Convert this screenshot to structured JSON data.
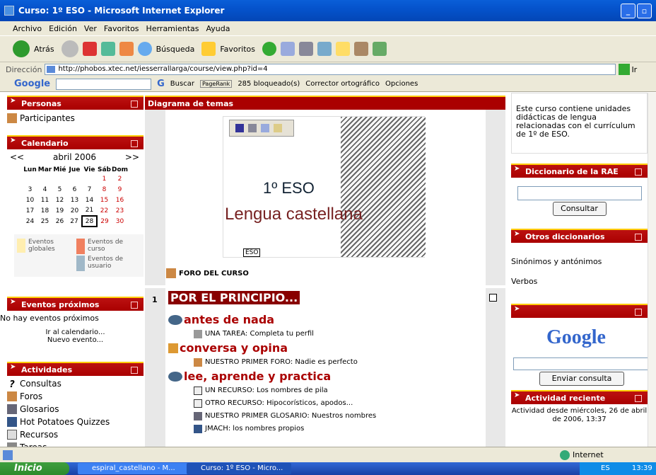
{
  "window": {
    "title": "Curso: 1º ESO - Microsoft Internet Explorer"
  },
  "menu": [
    "Archivo",
    "Edición",
    "Ver",
    "Favoritos",
    "Herramientas",
    "Ayuda"
  ],
  "toolbar": {
    "back": "Atrás",
    "search": "Búsqueda",
    "favorites": "Favoritos"
  },
  "address": {
    "label": "Dirección",
    "url": "http://phobos.xtec.net/iesserrallarga/course/view.php?id=4",
    "go": "Ir"
  },
  "googlebar": {
    "logo": "Google",
    "search": "Buscar",
    "pagerank": "PageRank",
    "blocked": "285 bloqueado(s)",
    "spell": "Corrector ortográfico",
    "options": "Opciones"
  },
  "left": {
    "personas": {
      "title": "Personas",
      "items": [
        "Participantes"
      ]
    },
    "calendario": {
      "title": "Calendario",
      "prev": "<<",
      "month": "abril 2006",
      "next": ">>",
      "days": [
        "Lun",
        "Mar",
        "Mié",
        "Jue",
        "Vie",
        "Sáb",
        "Dom"
      ],
      "weeks": [
        [
          "",
          "",
          "",
          "",
          "",
          "1",
          "2"
        ],
        [
          "3",
          "4",
          "5",
          "6",
          "7",
          "8",
          "9"
        ],
        [
          "10",
          "11",
          "12",
          "13",
          "14",
          "15",
          "16"
        ],
        [
          "17",
          "18",
          "19",
          "20",
          "21",
          "22",
          "23"
        ],
        [
          "24",
          "25",
          "26",
          "27",
          "28",
          "29",
          "30"
        ]
      ],
      "legend": {
        "global": "Eventos globales",
        "course": "Eventos de curso",
        "user": "Eventos de usuario"
      }
    },
    "eventos": {
      "title": "Eventos próximos",
      "none": "No hay eventos próximos",
      "goto": "Ir al calendario...",
      "new": "Nuevo evento..."
    },
    "actividades": {
      "title": "Actividades",
      "items": [
        "Consultas",
        "Foros",
        "Glosarios",
        "Hot Potatoes Quizzes",
        "Recursos",
        "Tareas"
      ]
    }
  },
  "main": {
    "header": "Diagrama de temas",
    "banner": {
      "line1": "1º ESO",
      "line2": "Lengua castellana",
      "tag": "ESO"
    },
    "forum": "FORO DEL CURSO",
    "section": {
      "num": "1",
      "title": "POR EL PRINCIPIO...",
      "topics": [
        {
          "heading": "antes de nada",
          "items": [
            "UNA TAREA: Completa tu perfil"
          ]
        },
        {
          "heading": "conversa y opina",
          "items": [
            "NUESTRO PRIMER FORO: Nadie es perfecto"
          ]
        },
        {
          "heading": "lee, aprende y practica",
          "items": [
            "UN RECURSO: Los nombres de pila",
            "OTRO RECURSO: Hipocorísticos, apodos...",
            "NUESTRO PRIMER GLOSARIO: Nuestros nombres",
            "JMACH: los nombres propios"
          ]
        }
      ]
    }
  },
  "right": {
    "summary": "Este curso contiene unidades didácticas de lengua relacionadas con el currículum de 1º de ESO.",
    "rae": {
      "title": "Diccionario de la RAE",
      "button": "Consultar"
    },
    "otros": {
      "title": "Otros diccionarios",
      "items": [
        "Sinónimos y antónimos",
        "Verbos"
      ]
    },
    "google": {
      "logo": "Google",
      "button": "Enviar consulta"
    },
    "reciente": {
      "title": "Actividad reciente",
      "text": "Actividad desde miércoles, 26 de abril de 2006, 13:37"
    }
  },
  "status": {
    "zone": "Internet"
  },
  "taskbar": {
    "start": "Inicio",
    "task1": "espiral_castellano - M...",
    "task2": "Curso: 1º ESO - Micro...",
    "lang": "ES",
    "time": "13:39"
  },
  "colors": {
    "accent": "#aa0000",
    "titlebar": "#0553cc"
  }
}
